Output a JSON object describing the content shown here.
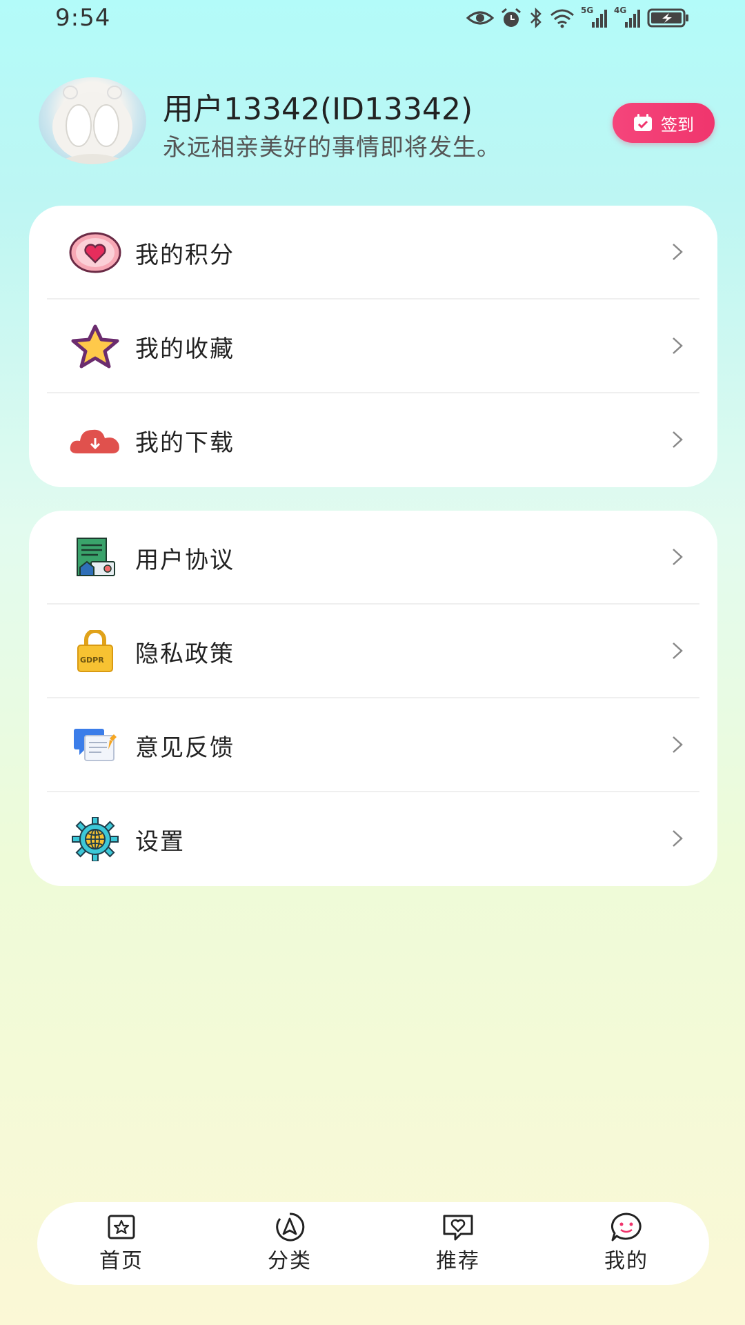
{
  "status_bar": {
    "time": "9:54",
    "net1": "5G",
    "net2": "4G"
  },
  "profile": {
    "username": "用户13342(ID13342)",
    "motto": "永远相亲美好的事情即将发生。",
    "signin_label": "签到"
  },
  "menu_group_1": [
    {
      "label": "我的积分",
      "icon": "heart-badge-icon"
    },
    {
      "label": "我的收藏",
      "icon": "star-icon"
    },
    {
      "label": "我的下载",
      "icon": "cloud-download-icon"
    }
  ],
  "menu_group_2": [
    {
      "label": "用户协议",
      "icon": "document-icon"
    },
    {
      "label": "隐私政策",
      "icon": "gdpr-lock-icon",
      "icon_text": "GDPR"
    },
    {
      "label": "意见反馈",
      "icon": "feedback-icon"
    },
    {
      "label": "设置",
      "icon": "gear-globe-icon"
    }
  ],
  "tabbar": [
    {
      "label": "首页",
      "icon": "home-star-icon"
    },
    {
      "label": "分类",
      "icon": "compass-icon"
    },
    {
      "label": "推荐",
      "icon": "chat-heart-icon"
    },
    {
      "label": "我的",
      "icon": "smile-icon",
      "active": true
    }
  ],
  "colors": {
    "accent": "#f0356d",
    "text": "#222222",
    "muted": "#555555"
  }
}
